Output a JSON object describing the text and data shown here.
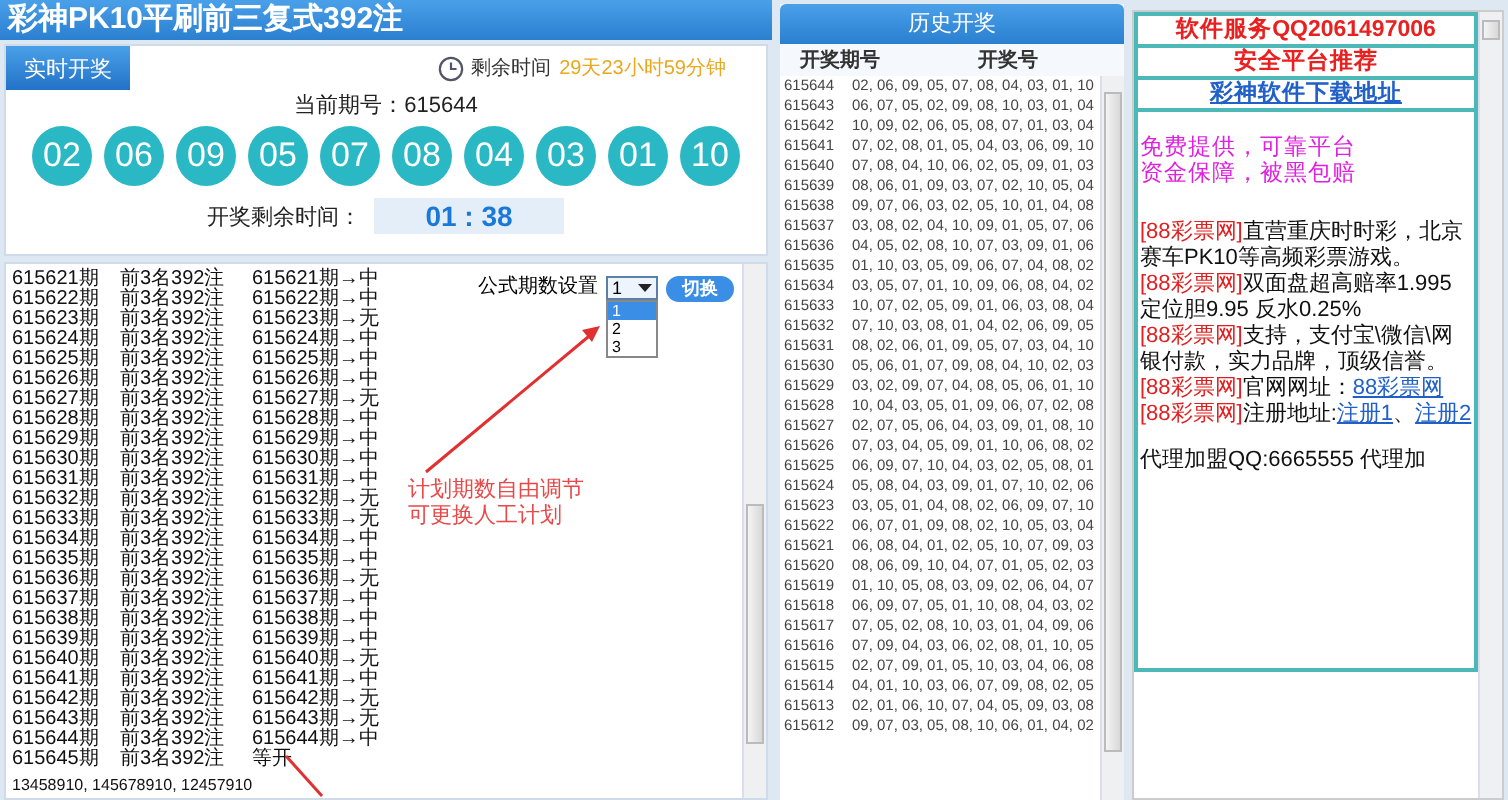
{
  "title": "彩神PK10平刷前三复式392注",
  "live": {
    "tab": "实时开奖",
    "remaining_label": "剩余时间",
    "remaining_value": "29天23小时59分钟",
    "period_label": "当前期号：615644",
    "balls": [
      "02",
      "06",
      "09",
      "05",
      "07",
      "08",
      "04",
      "03",
      "01",
      "10"
    ],
    "countdown_label": "开奖剩余时间：",
    "countdown": "01 : 38"
  },
  "plan": {
    "rows": [
      {
        "period": "615621期",
        "plan": "前3名392注",
        "result": "615621期→中"
      },
      {
        "period": "615622期",
        "plan": "前3名392注",
        "result": "615622期→中"
      },
      {
        "period": "615623期",
        "plan": "前3名392注",
        "result": "615623期→无"
      },
      {
        "period": "615624期",
        "plan": "前3名392注",
        "result": "615624期→中"
      },
      {
        "period": "615625期",
        "plan": "前3名392注",
        "result": "615625期→中"
      },
      {
        "period": "615626期",
        "plan": "前3名392注",
        "result": "615626期→中"
      },
      {
        "period": "615627期",
        "plan": "前3名392注",
        "result": "615627期→无"
      },
      {
        "period": "615628期",
        "plan": "前3名392注",
        "result": "615628期→中"
      },
      {
        "period": "615629期",
        "plan": "前3名392注",
        "result": "615629期→中"
      },
      {
        "period": "615630期",
        "plan": "前3名392注",
        "result": "615630期→中"
      },
      {
        "period": "615631期",
        "plan": "前3名392注",
        "result": "615631期→中"
      },
      {
        "period": "615632期",
        "plan": "前3名392注",
        "result": "615632期→无"
      },
      {
        "period": "615633期",
        "plan": "前3名392注",
        "result": "615633期→无"
      },
      {
        "period": "615634期",
        "plan": "前3名392注",
        "result": "615634期→中"
      },
      {
        "period": "615635期",
        "plan": "前3名392注",
        "result": "615635期→中"
      },
      {
        "period": "615636期",
        "plan": "前3名392注",
        "result": "615636期→无"
      },
      {
        "period": "615637期",
        "plan": "前3名392注",
        "result": "615637期→中"
      },
      {
        "period": "615638期",
        "plan": "前3名392注",
        "result": "615638期→中"
      },
      {
        "period": "615639期",
        "plan": "前3名392注",
        "result": "615639期→中"
      },
      {
        "period": "615640期",
        "plan": "前3名392注",
        "result": "615640期→无"
      },
      {
        "period": "615641期",
        "plan": "前3名392注",
        "result": "615641期→中"
      },
      {
        "period": "615642期",
        "plan": "前3名392注",
        "result": "615642期→无"
      },
      {
        "period": "615643期",
        "plan": "前3名392注",
        "result": "615643期→无"
      },
      {
        "period": "615644期",
        "plan": "前3名392注",
        "result": "615644期→中"
      },
      {
        "period": "615645期",
        "plan": "前3名392注",
        "result": "等开"
      }
    ],
    "footer": "13458910, 145678910, 12457910",
    "setting_label": "公式期数设置",
    "select": {
      "value": "1",
      "options": [
        {
          "label": "1",
          "selected": true
        },
        {
          "label": "2",
          "selected": false
        },
        {
          "label": "3",
          "selected": false
        }
      ]
    },
    "switch_button": "切换",
    "annotation": [
      "计划期数自由调节",
      "可更换人工计划"
    ]
  },
  "history": {
    "title": "历史开奖",
    "columns": [
      "开奖期号",
      "开奖号"
    ],
    "rows": [
      {
        "period": "615644",
        "numbers": "02, 06, 09, 05, 07, 08, 04, 03, 01, 10"
      },
      {
        "period": "615643",
        "numbers": "06, 07, 05, 02, 09, 08, 10, 03, 01, 04"
      },
      {
        "period": "615642",
        "numbers": "10, 09, 02, 06, 05, 08, 07, 01, 03, 04"
      },
      {
        "period": "615641",
        "numbers": "07, 02, 08, 01, 05, 04, 03, 06, 09, 10"
      },
      {
        "period": "615640",
        "numbers": "07, 08, 04, 10, 06, 02, 05, 09, 01, 03"
      },
      {
        "period": "615639",
        "numbers": "08, 06, 01, 09, 03, 07, 02, 10, 05, 04"
      },
      {
        "period": "615638",
        "numbers": "09, 07, 06, 03, 02, 05, 10, 01, 04, 08"
      },
      {
        "period": "615637",
        "numbers": "03, 08, 02, 04, 10, 09, 01, 05, 07, 06"
      },
      {
        "period": "615636",
        "numbers": "04, 05, 02, 08, 10, 07, 03, 09, 01, 06"
      },
      {
        "period": "615635",
        "numbers": "01, 10, 03, 05, 09, 06, 07, 04, 08, 02"
      },
      {
        "period": "615634",
        "numbers": "03, 05, 07, 01, 10, 09, 06, 08, 04, 02"
      },
      {
        "period": "615633",
        "numbers": "10, 07, 02, 05, 09, 01, 06, 03, 08, 04"
      },
      {
        "period": "615632",
        "numbers": "07, 10, 03, 08, 01, 04, 02, 06, 09, 05"
      },
      {
        "period": "615631",
        "numbers": "08, 02, 06, 01, 09, 05, 07, 03, 04, 10"
      },
      {
        "period": "615630",
        "numbers": "05, 06, 01, 07, 09, 08, 04, 10, 02, 03"
      },
      {
        "period": "615629",
        "numbers": "03, 02, 09, 07, 04, 08, 05, 06, 01, 10"
      },
      {
        "period": "615628",
        "numbers": "10, 04, 03, 05, 01, 09, 06, 07, 02, 08"
      },
      {
        "period": "615627",
        "numbers": "02, 07, 05, 06, 04, 03, 09, 01, 08, 10"
      },
      {
        "period": "615626",
        "numbers": "07, 03, 04, 05, 09, 01, 10, 06, 08, 02"
      },
      {
        "period": "615625",
        "numbers": "06, 09, 07, 10, 04, 03, 02, 05, 08, 01"
      },
      {
        "period": "615624",
        "numbers": "05, 08, 04, 03, 09, 01, 07, 10, 02, 06"
      },
      {
        "period": "615623",
        "numbers": "03, 05, 01, 04, 08, 02, 06, 09, 07, 10"
      },
      {
        "period": "615622",
        "numbers": "06, 07, 01, 09, 08, 02, 10, 05, 03, 04"
      },
      {
        "period": "615621",
        "numbers": "06, 08, 04, 01, 02, 05, 10, 07, 09, 03"
      },
      {
        "period": "615620",
        "numbers": "08, 06, 09, 10, 04, 07, 01, 05, 02, 03"
      },
      {
        "period": "615619",
        "numbers": "01, 10, 05, 08, 03, 09, 02, 06, 04, 07"
      },
      {
        "period": "615618",
        "numbers": "06, 09, 07, 05, 01, 10, 08, 04, 03, 02"
      },
      {
        "period": "615617",
        "numbers": "07, 05, 02, 08, 10, 03, 01, 04, 09, 06"
      },
      {
        "period": "615616",
        "numbers": "07, 09, 04, 03, 06, 02, 08, 01, 10, 05"
      },
      {
        "period": "615615",
        "numbers": "02, 07, 09, 01, 05, 10, 03, 04, 06, 08"
      },
      {
        "period": "615614",
        "numbers": "04, 01, 10, 03, 06, 07, 09, 08, 02, 05"
      },
      {
        "period": "615613",
        "numbers": "02, 01, 06, 10, 07, 04, 05, 09, 03, 08"
      },
      {
        "period": "615612",
        "numbers": "09, 07, 03, 05, 08, 10, 06, 01, 04, 02"
      }
    ]
  },
  "ads": {
    "service": "软件服务QQ2061497006",
    "recommend": "安全平台推荐",
    "download_link": "彩神软件下载地址",
    "promo": [
      "免费提供，可靠平台",
      "资金保障，被黑包赔"
    ],
    "items": [
      {
        "tag": "[88彩票网]",
        "text": "直营重庆时时彩，北京赛车PK10等高频彩票游戏。"
      },
      {
        "tag": "[88彩票网]",
        "text": "双面盘超高赔率1.995 定位胆9.95 反水0.25%"
      },
      {
        "tag": "[88彩票网]",
        "text": "支持，支付宝\\微信\\网银付款，实力品牌，顶级信誉。"
      },
      {
        "tag": "[88彩票网]",
        "text": "官网网址：",
        "links": [
          "88彩票网"
        ]
      },
      {
        "tag": "[88彩票网]",
        "text": "注册地址:",
        "links": [
          "注册1",
          "注册2"
        ],
        "separator": "、"
      }
    ],
    "agent": "代理加盟QQ:6665555 代理加"
  }
}
